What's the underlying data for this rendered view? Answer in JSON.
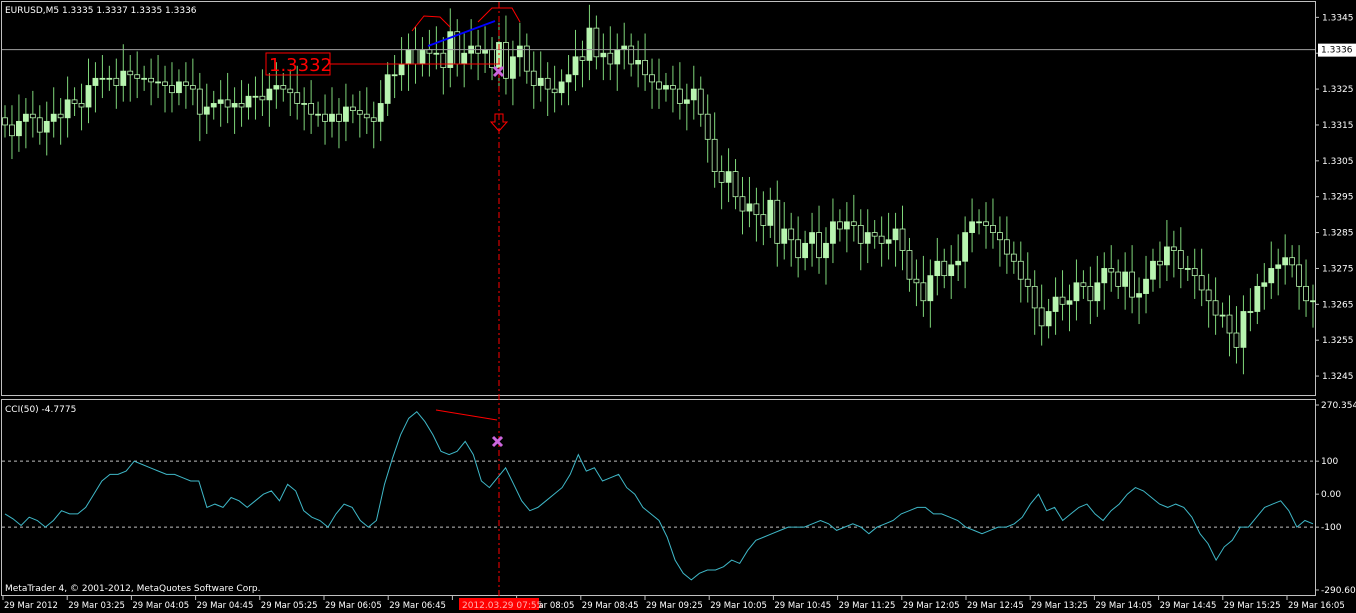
{
  "colors": {
    "background": "#000000",
    "frame": "#c0c0c0",
    "bull_body": "#b8f5b0",
    "candle_wick": "#7fd67a",
    "cci_line": "#3fb8c8",
    "annotation_red": "#ff0000",
    "trendline_blue": "#0000ff",
    "cross_magenta": "#cc66dd",
    "text": "#ffffff"
  },
  "price_panel": {
    "title": "EURUSD,M5  1.3335 1.3337 1.3335 1.3336",
    "current_price_label": "1.3336",
    "current_price": 1.3336,
    "level_label": "1.3332",
    "level_price": 1.3332,
    "axis_ticks": [
      "1.3345",
      "1.3335",
      "1.3325",
      "1.3315",
      "1.3305",
      "1.3295",
      "1.3285",
      "1.3275",
      "1.3265",
      "1.3255",
      "1.3245"
    ]
  },
  "cci_panel": {
    "title": "CCI(50) -4.7775",
    "axis_ticks": [
      "270.354",
      "100",
      "0.00",
      "-100",
      "-290.602"
    ]
  },
  "time_axis": {
    "labels": [
      "29 Mar 2012",
      "29 Mar 03:25",
      "29 Mar 04:05",
      "29 Mar 04:45",
      "29 Mar 05:25",
      "29 Mar 06:05",
      "29 Mar 06:45",
      "",
      "29 Mar 08:05",
      "29 Mar 08:45",
      "29 Mar 09:25",
      "29 Mar 10:05",
      "29 Mar 10:45",
      "29 Mar 11:25",
      "29 Mar 12:05",
      "29 Mar 12:45",
      "29 Mar 13:25",
      "29 Mar 14:05",
      "29 Mar 14:45",
      "29 Mar 15:25",
      "29 Mar 16:05"
    ],
    "cursor_label": "2012.03.29 07:55"
  },
  "copyright": "MetaTrader 4, © 2001-2012, MetaQuotes Software Corp.",
  "chart_data": [
    {
      "type": "candlestick",
      "title": "EURUSD,M5  1.3335 1.3337 1.3335 1.3336",
      "ylim": [
        1.324,
        1.3349
      ],
      "grid": false,
      "series": [
        {
          "name": "EURUSD",
          "close": [
            1.3315,
            1.3312,
            1.3316,
            1.3318,
            1.3317,
            1.3313,
            1.3316,
            1.3318,
            1.3317,
            1.3322,
            1.3321,
            1.332,
            1.3326,
            1.3328,
            1.3328,
            1.3328,
            1.3326,
            1.333,
            1.3329,
            1.3328,
            1.3328,
            1.3327,
            1.3327,
            1.3326,
            1.3324,
            1.3327,
            1.3326,
            1.3325,
            1.3318,
            1.332,
            1.3321,
            1.3322,
            1.332,
            1.3321,
            1.332,
            1.3323,
            1.3323,
            1.3322,
            1.3325,
            1.3326,
            1.3325,
            1.3324,
            1.3321,
            1.3321,
            1.3318,
            1.3318,
            1.3316,
            1.3318,
            1.3316,
            1.332,
            1.3319,
            1.3318,
            1.3317,
            1.3316,
            1.3321,
            1.3329,
            1.3329,
            1.3332,
            1.3336,
            1.3332,
            1.3336,
            1.3335,
            1.3335,
            1.3331,
            1.3341,
            1.3332,
            1.3335,
            1.3337,
            1.3335,
            1.3336,
            1.3331,
            1.3338,
            1.3328,
            1.3334,
            1.3337,
            1.333,
            1.3326,
            1.3328,
            1.3325,
            1.3324,
            1.3327,
            1.3329,
            1.3334,
            1.3333,
            1.3342,
            1.3334,
            1.3335,
            1.3332,
            1.3336,
            1.3337,
            1.3332,
            1.3333,
            1.3329,
            1.3327,
            1.3325,
            1.3326,
            1.3325,
            1.3321,
            1.3322,
            1.3325,
            1.3318,
            1.3311,
            1.3302,
            1.3299,
            1.3302,
            1.3295,
            1.3291,
            1.3293,
            1.329,
            1.3287,
            1.3294,
            1.3282,
            1.3286,
            1.3283,
            1.3278,
            1.3282,
            1.3285,
            1.3278,
            1.3282,
            1.3288,
            1.3286,
            1.3288,
            1.3287,
            1.3282,
            1.3285,
            1.3284,
            1.3282,
            1.3283,
            1.3286,
            1.328,
            1.3272,
            1.3271,
            1.3266,
            1.3273,
            1.3277,
            1.3273,
            1.3276,
            1.3277,
            1.3285,
            1.3288,
            1.3288,
            1.3287,
            1.3285,
            1.3283,
            1.3279,
            1.3277,
            1.3272,
            1.327,
            1.3264,
            1.3259,
            1.3263,
            1.3267,
            1.3265,
            1.3266,
            1.3271,
            1.327,
            1.3266,
            1.3271,
            1.3275,
            1.3274,
            1.327,
            1.3274,
            1.3267,
            1.3268,
            1.3272,
            1.3277,
            1.3276,
            1.3281,
            1.328,
            1.3275,
            1.3275,
            1.3273,
            1.3269,
            1.3266,
            1.3262,
            1.3262,
            1.3257,
            1.3253,
            1.3263,
            1.3263,
            1.327,
            1.3271,
            1.3275,
            1.3276,
            1.3278,
            1.3276,
            1.327,
            1.3266,
            1.3266
          ]
        }
      ],
      "annotations": {
        "cursor_time": "2012.03.29 07:55",
        "horizontal_level": 1.3332
      }
    },
    {
      "type": "line",
      "title": "CCI(50) -4.7775",
      "ylim": [
        -290.602,
        270.354
      ],
      "levels": [
        100,
        0,
        -100
      ],
      "series": [
        {
          "name": "CCI(50)",
          "values": [
            -60,
            -75,
            -95,
            -70,
            -80,
            -100,
            -80,
            -50,
            -60,
            -60,
            -40,
            0,
            40,
            60,
            60,
            70,
            100,
            90,
            80,
            70,
            60,
            60,
            50,
            40,
            40,
            -40,
            -30,
            -40,
            -10,
            -20,
            -40,
            -20,
            0,
            10,
            -20,
            30,
            10,
            -50,
            -70,
            -80,
            -100,
            -60,
            -30,
            -40,
            -80,
            -100,
            -80,
            30,
            110,
            180,
            230,
            250,
            220,
            180,
            130,
            120,
            130,
            160,
            120,
            40,
            20,
            50,
            80,
            30,
            -20,
            -50,
            -40,
            -20,
            0,
            20,
            60,
            120,
            70,
            80,
            40,
            50,
            60,
            20,
            0,
            -40,
            -60,
            -80,
            -130,
            -200,
            -240,
            -260,
            -240,
            -230,
            -230,
            -220,
            -200,
            -210,
            -170,
            -140,
            -130,
            -120,
            -110,
            -100,
            -100,
            -100,
            -90,
            -80,
            -90,
            -110,
            -100,
            -90,
            -100,
            -120,
            -100,
            -90,
            -80,
            -60,
            -50,
            -40,
            -40,
            -60,
            -60,
            -70,
            -80,
            -100,
            -110,
            -120,
            -110,
            -100,
            -100,
            -90,
            -70,
            -30,
            0,
            -50,
            -40,
            -80,
            -60,
            -40,
            -30,
            -60,
            -80,
            -50,
            -30,
            0,
            20,
            10,
            -10,
            -30,
            -40,
            -30,
            -40,
            -70,
            -120,
            -150,
            -200,
            -160,
            -140,
            -100,
            -100,
            -70,
            -40,
            -30,
            -20,
            -50,
            -100,
            -80,
            -90
          ]
        }
      ]
    }
  ]
}
